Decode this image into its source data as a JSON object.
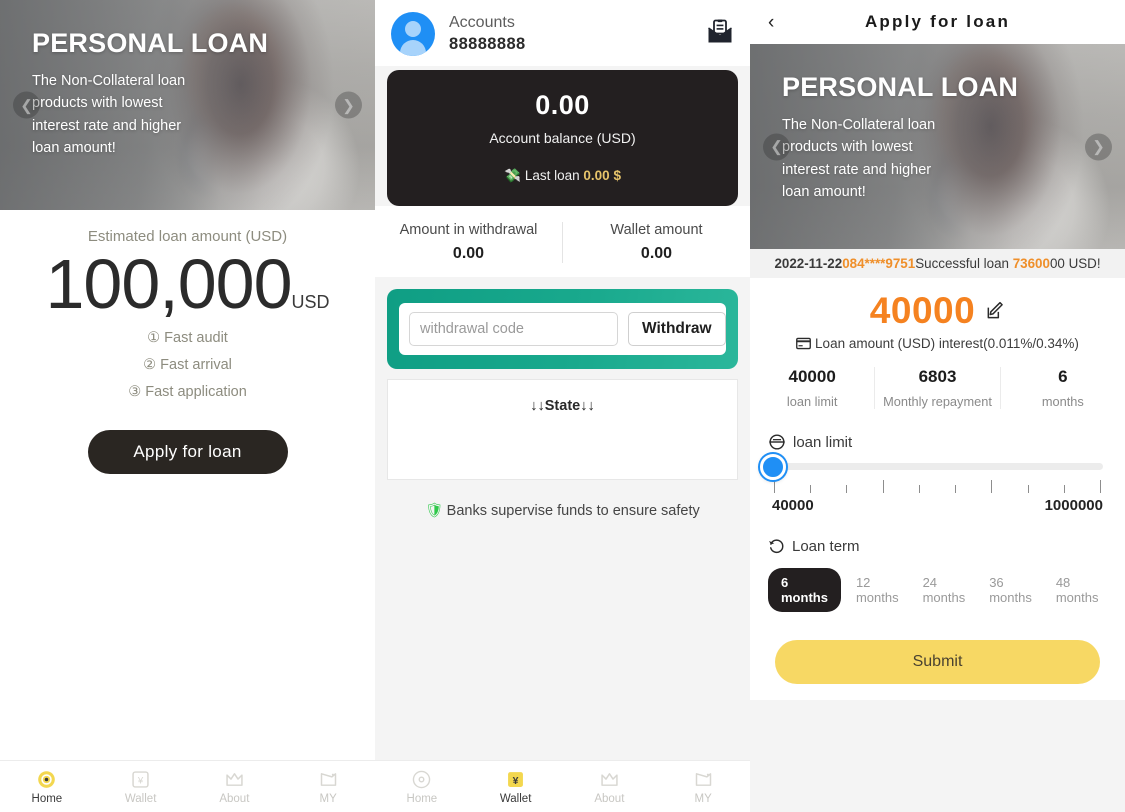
{
  "banner": {
    "title": "PERSONAL LOAN",
    "subtitle": "The Non-Collateral loan products with lowest interest rate and higher loan amount!",
    "prev_icon": "chevron-left-icon",
    "next_icon": "chevron-right-icon"
  },
  "home": {
    "estimated_label": "Estimated loan amount (USD)",
    "amount": "100,000",
    "amount_unit": "USD",
    "features": [
      "① Fast audit",
      "② Fast arrival",
      "③ Fast application"
    ],
    "apply_label": "Apply for loan"
  },
  "tabbar": {
    "items": [
      {
        "label": "Home",
        "icon": "home-target-icon"
      },
      {
        "label": "Wallet",
        "icon": "wallet-yen-icon"
      },
      {
        "label": "About",
        "icon": "about-crown-icon"
      },
      {
        "label": "MY",
        "icon": "my-folder-icon"
      }
    ],
    "left_active": "Home",
    "mid_active": "Wallet"
  },
  "wallet": {
    "account_label": "Accounts",
    "account_number": "88888888",
    "mail_icon": "envelope-mail-icon",
    "balance_value": "0.00",
    "balance_label": "Account balance (USD)",
    "last_loan_prefix": "Last loan",
    "last_loan_value": "0.00",
    "last_loan_suffix": "$",
    "last_loan_icon": "cash-stack-icon",
    "stats": [
      {
        "label": "Amount in withdrawal",
        "value": "0.00"
      },
      {
        "label": "Wallet amount",
        "value": "0.00"
      }
    ],
    "withdraw_placeholder": "withdrawal code",
    "withdraw_value": "",
    "withdraw_button": "Withdraw",
    "state_title": "↓↓State↓↓",
    "safety_text": "Banks supervise funds to ensure safety",
    "safety_icon": "shield-icon"
  },
  "apply": {
    "nav_title": "Apply for loan",
    "back_icon": "chevron-left-icon",
    "ticker": {
      "date": "2022-11-22",
      "phone": "084****9751",
      "middle": "Successful loan ",
      "amount_hl": "73600",
      "amount_rest": "00 USD!"
    },
    "loan_amount": "40000",
    "edit_icon": "edit-pencil-icon",
    "amount_caption": "Loan amount (USD) interest(0.011%/0.34%)",
    "amount_caption_icon": "credit-card-icon",
    "stats": [
      {
        "value": "40000",
        "label": "loan limit"
      },
      {
        "value": "6803",
        "label": "Monthly repayment"
      },
      {
        "value": "6",
        "label": "months"
      }
    ],
    "limit_section_title": "loan limit",
    "limit_section_icon": "coin-icon",
    "slider": {
      "min_label": "40000",
      "max_label": "1000000",
      "value_percent": 0
    },
    "term_section_title": "Loan term",
    "term_section_icon": "history-clock-icon",
    "terms": [
      "6 months",
      "12 months",
      "24 months",
      "36 months",
      "48 months"
    ],
    "active_term": "6 months",
    "submit_label": "Submit"
  },
  "colors": {
    "accent_orange": "#f58220",
    "teal": "#0f9e84",
    "submit_yellow": "#f7d864",
    "dark": "#231f20",
    "blue": "#1f8ff5"
  }
}
